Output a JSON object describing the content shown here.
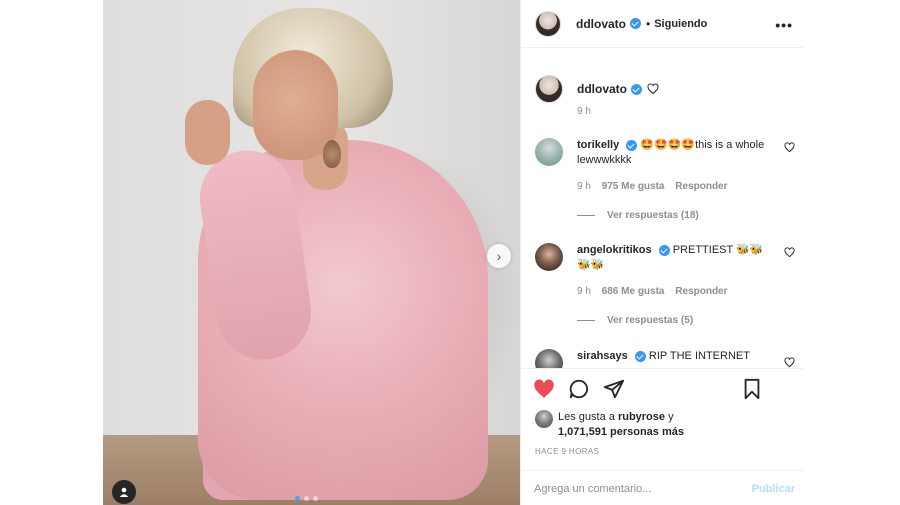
{
  "header": {
    "username": "ddlovato",
    "separator": "•",
    "status": "Siguiendo",
    "more_glyph": "•••"
  },
  "caption": {
    "username": "ddlovato",
    "time": "9 h"
  },
  "comments": [
    {
      "username": "torikelly",
      "text": "🤩🤩🤩🤩this is a whole lewwwkkkk",
      "time": "9 h",
      "likes": "975 Me gusta",
      "reply": "Responder",
      "replies": "Ver respuestas (18)"
    },
    {
      "username": "angelokritikos",
      "text": "PRETTIEST 🐝🐝🐝🐝",
      "time": "9 h",
      "likes": "686 Me gusta",
      "reply": "Responder",
      "replies": "Ver respuestas (5)"
    },
    {
      "username": "sirahsays",
      "text": "RIP THE INTERNET"
    }
  ],
  "likes": {
    "prefix": "Les gusta a",
    "user": "rubyrose",
    "connector": "y",
    "count": "1,071,591 personas más"
  },
  "timestamp": "HACE 9 HORAS",
  "comment_input": {
    "placeholder": "Agrega un comentario...",
    "submit": "Publicar"
  },
  "carousel": {
    "total_slides": 3,
    "active_slide": 1
  },
  "colors": {
    "like_active": "#ed4956",
    "verified": "#3897f0",
    "carousel_active_dot": "#4aa3f0",
    "publish_disabled": "#b2dffc"
  },
  "icons": [
    "heart-filled-icon",
    "comment-icon",
    "share-icon",
    "bookmark-icon",
    "chevron-right-icon",
    "person-tag-icon",
    "verified-badge-icon",
    "heart-outline-icon"
  ]
}
